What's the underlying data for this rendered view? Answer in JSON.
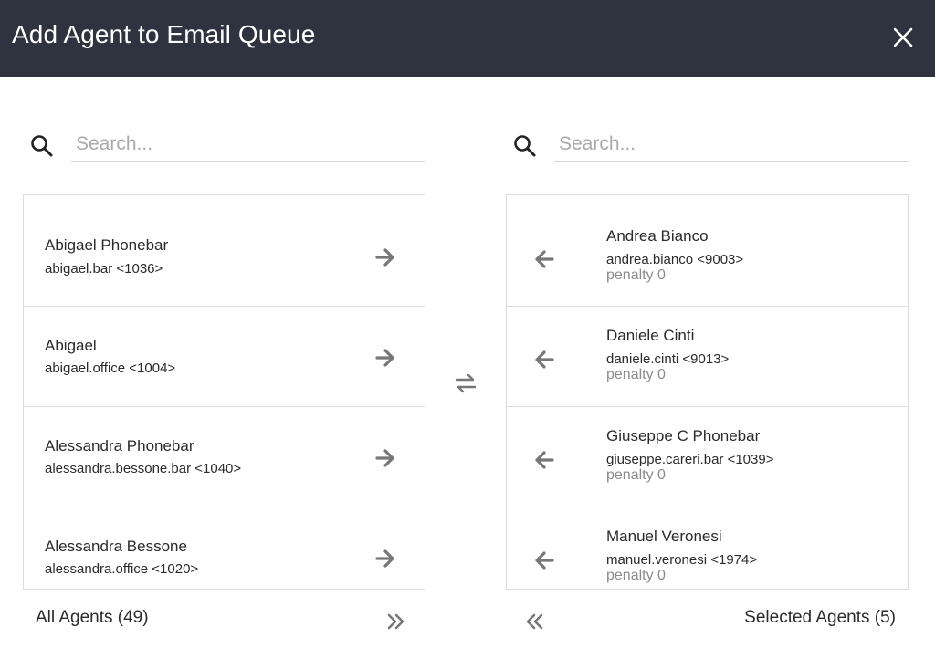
{
  "dialog": {
    "title": "Add Agent to Email Queue",
    "close_icon": "close-icon"
  },
  "colors": {
    "header_bg": "#2e333f",
    "icon_gray": "#777777",
    "penalty_gray": "#8c8c8c"
  },
  "left_panel": {
    "search_placeholder": "Search...",
    "search_value": "",
    "footer_label": "All Agents (49)",
    "move_all_icon": "double-chevron-right-icon",
    "agents": [
      {
        "name": "Abigael Phonebar",
        "uid": "abigael.bar <1036>"
      },
      {
        "name": "Abigael",
        "uid": "abigael.office <1004>"
      },
      {
        "name": "Alessandra Phonebar",
        "uid": "alessandra.bessone.bar <1040>"
      },
      {
        "name": "Alessandra Bessone",
        "uid": "alessandra.office <1020>"
      }
    ]
  },
  "swap_icon": "swap-arrows-icon",
  "right_panel": {
    "search_placeholder": "Search...",
    "search_value": "",
    "footer_label": "Selected Agents (5)",
    "move_all_icon": "double-chevron-left-icon",
    "agents": [
      {
        "name": "Andrea Bianco",
        "uid": "andrea.bianco <9003>",
        "penalty": "penalty 0"
      },
      {
        "name": "Daniele Cinti",
        "uid": "daniele.cinti <9013>",
        "penalty": "penalty 0"
      },
      {
        "name": "Giuseppe C Phonebar",
        "uid": "giuseppe.careri.bar <1039>",
        "penalty": "penalty 0"
      },
      {
        "name": "Manuel Veronesi",
        "uid": "manuel.veronesi <1974>",
        "penalty": "penalty 0"
      }
    ]
  }
}
